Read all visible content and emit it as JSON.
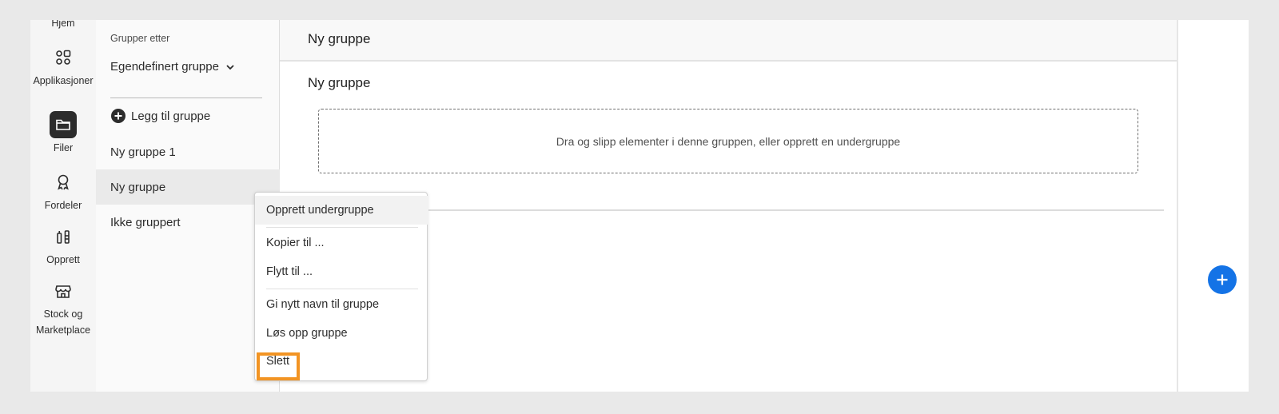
{
  "rail": {
    "items": [
      {
        "label": "Hjem",
        "icon": "home-icon"
      },
      {
        "label": "Applikasjoner",
        "icon": "apps-icon"
      },
      {
        "label": "Filer",
        "icon": "folder-icon",
        "active": true
      },
      {
        "label": "Fordeler",
        "icon": "ribbon-icon"
      },
      {
        "label": "Opprett",
        "icon": "create-tools-icon"
      },
      {
        "label": "Stock og Marketplace",
        "icon": "storefront-icon"
      }
    ]
  },
  "groups": {
    "group_by_label": "Grupper etter",
    "group_by_value": "Egendefinert gruppe",
    "add_group_label": "Legg til gruppe",
    "items": [
      {
        "label": "Ny gruppe 1"
      },
      {
        "label": "Ny gruppe",
        "selected": true
      },
      {
        "label": "Ikke gruppert"
      }
    ]
  },
  "main": {
    "header_title": "Ny gruppe",
    "section_title": "Ny gruppe",
    "dropzone_text": "Dra og slipp elementer i denne gruppen, eller opprett en undergruppe"
  },
  "context_menu": {
    "items": [
      {
        "label": "Opprett undergruppe"
      },
      {
        "label": "Kopier til ..."
      },
      {
        "label": "Flytt til ..."
      },
      {
        "label": "Gi nytt navn til gruppe"
      },
      {
        "label": "Løs opp gruppe"
      },
      {
        "label": "Slett",
        "highlighted": true
      }
    ]
  },
  "colors": {
    "accent": "#1473e6",
    "highlight": "#f29423",
    "active_rail": "#2c2c2c"
  }
}
